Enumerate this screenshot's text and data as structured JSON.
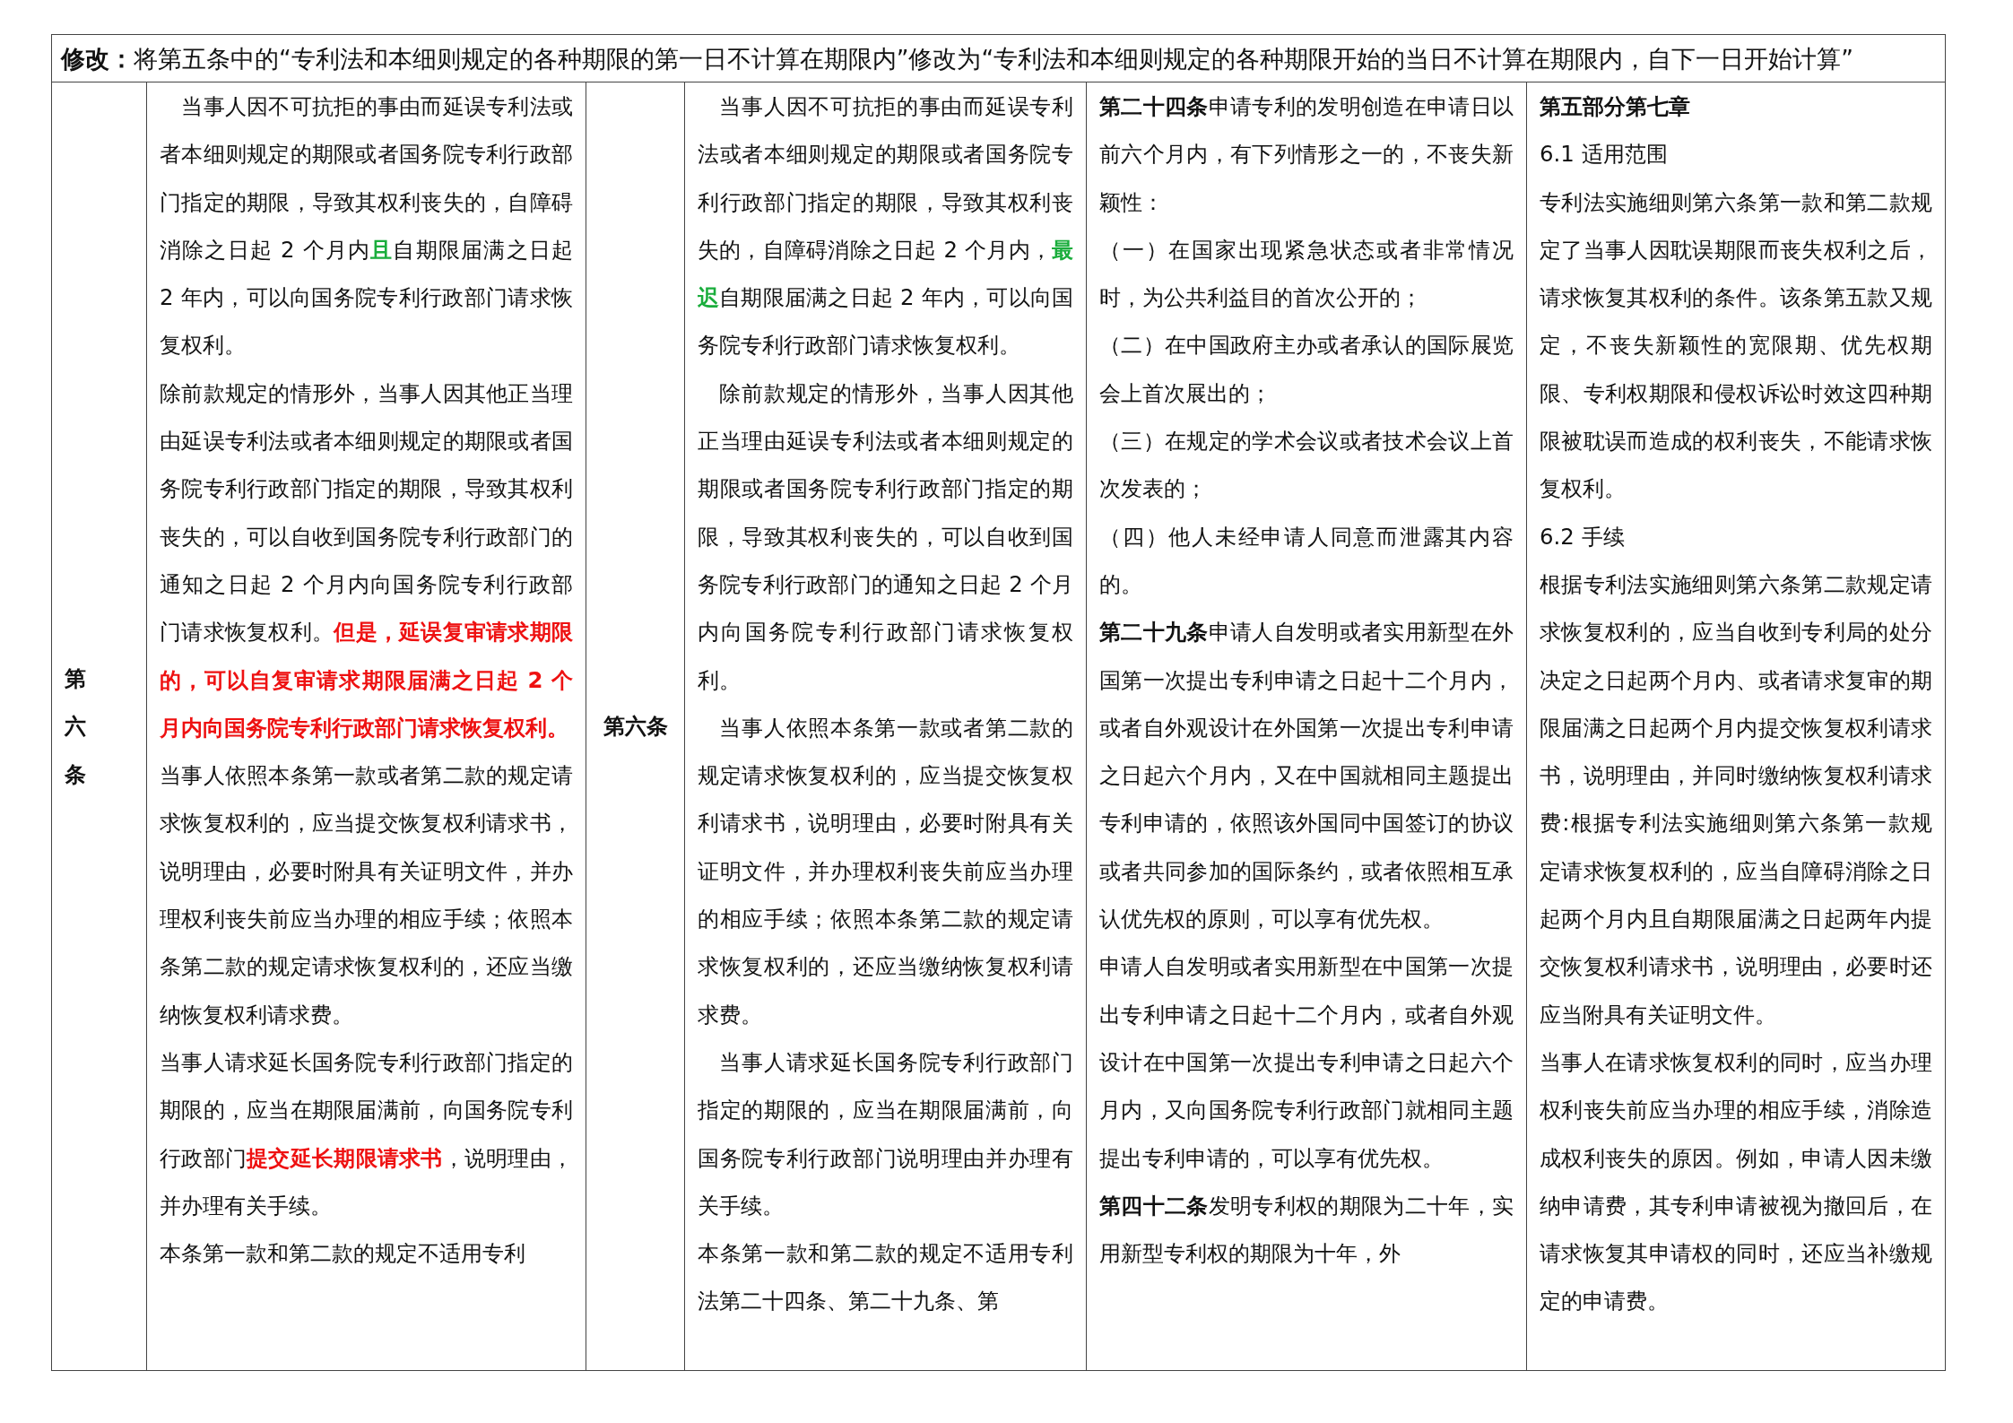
{
  "header": "**修改：**将第五条中的“专利法和本细则规定的各种期限的第一日不计算在期限内”修改为“专利法和本细则规定的各种期限开始的当日不计算在期限内，自下一日开始计算”",
  "cells": [
    {
      "kind": "label",
      "text": "第六条"
    },
    {
      "kind": "text",
      "paragraphs": [
        {
          "indent": true,
          "runs": [
            {
              "kind": "plain",
              "text": "当事人因不可抗拒的事由而延误专利法或者本细则规定的期限或者国务院专利行政部门指定的期限，导致其权利丧失的，自障碍消除之日起 2 个月内"
            },
            {
              "kind": "green",
              "text": "且"
            },
            {
              "kind": "plain",
              "text": "自期限届满之日起 2 年内，可以向国务院专利行政部门请求恢复权利。"
            }
          ]
        },
        {
          "indent": false,
          "runs": [
            {
              "kind": "plain",
              "text": "除前款规定的情形外，当事人因其他正当理由延误专利法或者本细则规定的期限或者国务院专利行政部门指定的期限，导致其权利丧失的，可以自收到国务院专利行政部门的通知之日起 2 个月内向国务院专利行政部门请求恢复权利。"
            },
            {
              "kind": "red",
              "text": "但是，延误复审请求期限的，可以自复审请求期限届满之日起 2 个月内向国务院专利行政部门请求恢复权利。"
            }
          ]
        },
        {
          "indent": false,
          "runs": [
            {
              "kind": "plain",
              "text": "当事人依照本条第一款或者第二款的规定请求恢复权利的，应当提交恢复权利请求书，说明理由，必要时附具有关证明文件，并办理权利丧失前应当办理的相应手续；依照本条第二款的规定请求恢复权利的，还应当缴纳恢复权利请求费。"
            }
          ]
        },
        {
          "indent": false,
          "runs": [
            {
              "kind": "plain",
              "text": "当事人请求延长国务院专利行政部门指定的期限的，应当在期限届满前，向国务院专利行政部门"
            },
            {
              "kind": "red",
              "text": "提交延长期限请求书"
            },
            {
              "kind": "plain",
              "text": "，说明理由，并办理有关手续。"
            }
          ]
        },
        {
          "indent": false,
          "runs": [
            {
              "kind": "plain",
              "text": "本条第一款和第二款的规定不适用专利"
            }
          ]
        }
      ]
    },
    {
      "kind": "label",
      "text": "第六条"
    },
    {
      "kind": "text",
      "paragraphs": [
        {
          "indent": true,
          "runs": [
            {
              "kind": "plain",
              "text": "当事人因不可抗拒的事由而延误专利法或者本细则规定的期限或者国务院专利行政部门指定的期限，导致其权利丧失的，自障碍消除之日起 2 个月内，"
            },
            {
              "kind": "green",
              "text": "最迟"
            },
            {
              "kind": "plain",
              "text": "自期限届满之日起 2 年内，可以向国务院专利行政部门请求恢复权利。"
            }
          ]
        },
        {
          "indent": true,
          "runs": [
            {
              "kind": "plain",
              "text": "除前款规定的情形外，当事人因其他正当理由延误专利法或者本细则规定的期限或者国务院专利行政部门指定的期限，导致其权利丧失的，可以自收到国务院专利行政部门的通知之日起 2 个月内向国务院专利行政部门请求恢复权利。"
            }
          ]
        },
        {
          "indent": true,
          "runs": [
            {
              "kind": "plain",
              "text": "当事人依照本条第一款或者第二款的规定请求恢复权利的，应当提交恢复权利请求书，说明理由，必要时附具有关证明文件，并办理权利丧失前应当办理的相应手续；依照本条第二款的规定请求恢复权利的，还应当缴纳恢复权利请求费。"
            }
          ]
        },
        {
          "indent": true,
          "runs": [
            {
              "kind": "plain",
              "text": "当事人请求延长国务院专利行政部门指定的期限的，应当在期限届满前，向国务院专利行政部门说明理由并办理有关手续。"
            }
          ]
        },
        {
          "indent": false,
          "runs": [
            {
              "kind": "plain",
              "text": "本条第一款和第二款的规定不适用专利法第二十四条、第二十九条、第"
            }
          ]
        }
      ]
    },
    {
      "kind": "text",
      "paragraphs": [
        {
          "indent": false,
          "runs": [
            {
              "kind": "bold",
              "text": "第二十四条"
            },
            {
              "kind": "plain",
              "text": "申请专利的发明创造在申请日以前六个月内，有下列情形之一的，不丧失新颖性："
            }
          ]
        },
        {
          "indent": false,
          "runs": [
            {
              "kind": "plain",
              "text": "（一）在国家出现紧急状态或者非常情况时，为公共利益目的首次公开的；"
            }
          ]
        },
        {
          "indent": false,
          "runs": [
            {
              "kind": "plain",
              "text": "（二）在中国政府主办或者承认的国际展览会上首次展出的；"
            }
          ]
        },
        {
          "indent": false,
          "runs": [
            {
              "kind": "plain",
              "text": "（三）在规定的学术会议或者技术会议上首次发表的；"
            }
          ]
        },
        {
          "indent": false,
          "runs": [
            {
              "kind": "plain",
              "text": "（四）他人未经申请人同意而泄露其内容的。"
            }
          ]
        },
        {
          "indent": false,
          "runs": [
            {
              "kind": "bold",
              "text": "第二十九条"
            },
            {
              "kind": "plain",
              "text": "申请人自发明或者实用新型在外国第一次提出专利申请之日起十二个月内，或者自外观设计在外国第一次提出专利申请之日起六个月内，又在中国就相同主题提出专利申请的，依照该外国同中国签订的协议或者共同参加的国际条约，或者依照相互承认优先权的原则，可以享有优先权。"
            }
          ]
        },
        {
          "indent": false,
          "runs": [
            {
              "kind": "plain",
              "text": "申请人自发明或者实用新型在中国第一次提出专利申请之日起十二个月内，或者自外观设计在中国第一次提出专利申请之日起六个月内，又向国务院专利行政部门就相同主题提出专利申请的，可以享有优先权。"
            }
          ]
        },
        {
          "indent": false,
          "runs": [
            {
              "kind": "bold",
              "text": "第四十二条"
            },
            {
              "kind": "plain",
              "text": "发明专利权的期限为二十年，实用新型专利权的期限为十年，外"
            }
          ]
        }
      ]
    },
    {
      "kind": "text",
      "paragraphs": [
        {
          "indent": false,
          "runs": [
            {
              "kind": "bold",
              "text": "第五部分第七章"
            }
          ]
        },
        {
          "indent": false,
          "runs": [
            {
              "kind": "plain",
              "text": "6.1 适用范围"
            }
          ]
        },
        {
          "indent": false,
          "runs": [
            {
              "kind": "plain",
              "text": "专利法实施细则第六条第一款和第二款规定了当事人因耽误期限而丧失权利之后，请求恢复其权利的条件。该条第五款又规定，不丧失新颖性的宽限期、优先权期限、专利权期限和侵权诉讼时效这四种期限被耽误而造成的权利丧失，不能请求恢复权利。"
            }
          ]
        },
        {
          "indent": false,
          "runs": [
            {
              "kind": "plain",
              "text": "6.2 手续"
            }
          ]
        },
        {
          "indent": false,
          "runs": [
            {
              "kind": "plain",
              "text": "根据专利法实施细则第六条第二款规定请求恢复权利的，应当自收到专利局的处分决定之日起两个月内、或者请求复审的期限届满之日起两个月内提交恢复权利请求书，说明理由，并同时缴纳恢复权利请求费:根据专利法实施细则第六条第一款规定请求恢复权利的，应当自障碍消除之日起两个月内且自期限届满之日起两年内提交恢复权利请求书，说明理由，必要时还应当附具有关证明文件。"
            }
          ]
        },
        {
          "indent": false,
          "runs": [
            {
              "kind": "plain",
              "text": "当事人在请求恢复权利的同时，应当办理权利丧失前应当办理的相应手续，消除造成权利丧失的原因。例如，申请人因未缴纳申请费，其专利申请被视为撤回后，在请求恢复其申请权的同时，还应当补缴规定的申请费。"
            }
          ]
        }
      ]
    }
  ]
}
